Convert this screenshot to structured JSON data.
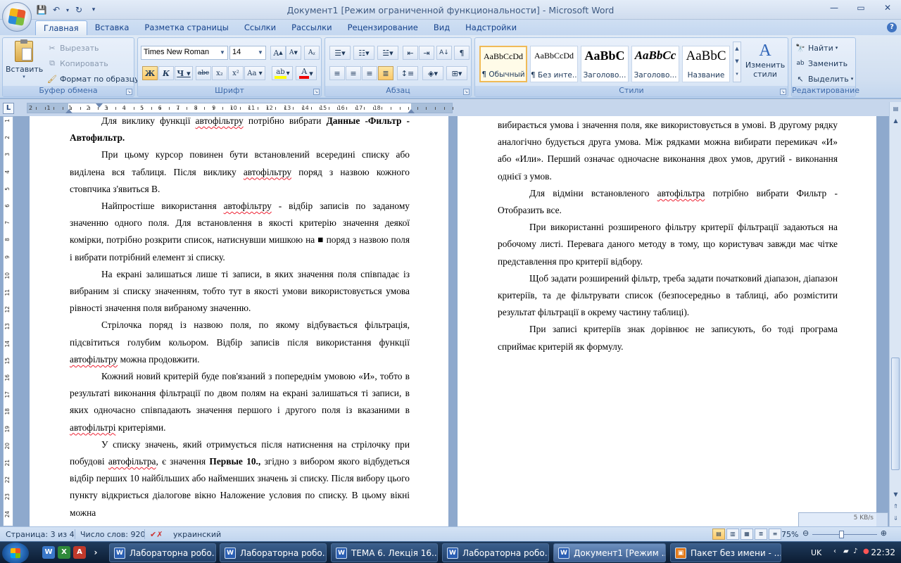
{
  "window": {
    "title": "Документ1 [Режим ограниченной функциональности] - Microsoft Word",
    "controls": [
      "—",
      "▭",
      "✕"
    ]
  },
  "tabs": [
    "Главная",
    "Вставка",
    "Разметка страницы",
    "Ссылки",
    "Рассылки",
    "Рецензирование",
    "Вид",
    "Надстройки"
  ],
  "ribbon": {
    "clipboard": {
      "label": "Буфер обмена",
      "paste": "Вставить",
      "cut": "Вырезать",
      "copy": "Копировать",
      "format_painter": "Формат по образцу"
    },
    "font": {
      "label": "Шрифт",
      "font_name": "Times New Roman",
      "font_size": "14"
    },
    "paragraph": {
      "label": "Абзац"
    },
    "styles": {
      "label": "Стили",
      "items": [
        {
          "sample": "AaBbCcDd",
          "name": "¶ Обычный"
        },
        {
          "sample": "AaBbCcDd",
          "name": "¶ Без инте..."
        },
        {
          "sample": "AaBbC",
          "name": "Заголово..."
        },
        {
          "sample": "AaBbCc",
          "name": "Заголово..."
        },
        {
          "sample": "AaBbC",
          "name": "Название"
        }
      ],
      "change_styles": "Изменить стили"
    },
    "editing": {
      "label": "Редактирование",
      "find": "Найти",
      "replace": "Заменить",
      "select": "Выделить"
    }
  },
  "ruler": {
    "ticks": [
      "2",
      "1",
      "1",
      "2",
      "3",
      "4",
      "5",
      "6",
      "7",
      "8",
      "9",
      "10",
      "11",
      "12",
      "13",
      "14",
      "15",
      "16",
      "17",
      "18"
    ],
    "vticks": [
      "1",
      "2",
      "3",
      "4",
      "5",
      "6",
      "7",
      "8",
      "9",
      "10",
      "11",
      "12",
      "13",
      "14",
      "15",
      "16",
      "17",
      "18",
      "19",
      "20",
      "21",
      "22",
      "23",
      "24",
      "25",
      "26"
    ]
  },
  "document": {
    "left_page": {
      "p1_a": "Для виклику функції ",
      "p1_w1": "автофільтру",
      "p1_b": " потрібно вибрати ",
      "p1_bold": "Данные -Фильтр - Автофильтр.",
      "p2_a": "При цьому курсор повинен бути встановлений всередині списку або виділена вся таблиця. Після виклику ",
      "p2_w1": "автофільтру",
      "p2_b": " поряд з назвою кожного стовпчика з'явиться В.",
      "p3_a": "Найпростіше використання ",
      "p3_w1": "автофільтру",
      "p3_b": " - відбір записів по заданому значенню одного поля. Для встановлення в якості критерію значення деякої комірки, потрібно розкрити список, натиснувши мишкою на ■ поряд з назвою поля і вибрати потрібний елемент зі списку.",
      "p4": "На екрані залишаться лише ті записи, в яких значення поля співпадає із вибраним зі списку значенням, тобто тут в якості умови використовується умова рівності значення поля вибраному значенню.",
      "p5_a": "Стрілочка поряд із назвою поля, по якому відбувається фільтрація, підсвітиться голубим кольором. Відбір записів після використання функції ",
      "p5_w1": "автофільтру",
      "p5_b": " можна продовжити.",
      "p6_a": "Кожний новий критерій буде пов'язаний з попереднім умовою «И», тобто в результаті виконання фільтрації по двом полям на екрані залишаться ті записи, в яких одночасно співпадають значення першого і другого поля із вказаними в ",
      "p6_w1": "автофільтрі",
      "p6_b": " критеріями.",
      "p7_a": "У списку значень, який отримується після натиснення на стрілочку при побудові ",
      "p7_w1": "автофільтра",
      "p7_b": ", є значення ",
      "p7_bold": "Первые 10.,",
      "p7_c": " згідно з вибором якого відбудеться відбір перших 10 найбільших або найменших значень зі списку. Після вибору цього пункту відкриється діалогове вікно Наложение условия по списку. В цьому вікні можна"
    },
    "right_page": {
      "p1": "вибирається умова і значення поля, яке використовується в умові. В другому рядку аналогічно будується друга умова. Між рядками можна вибирати перемикач «И» або «Или». Перший означає одночасне виконання двох умов, другий - виконання однієї з умов.",
      "p2_a": "Для відміни встановленого ",
      "p2_w1": "автофільтра",
      "p2_b": " потрібно вибрати Фильтр - Отобразить все.",
      "p3": "При використанні розширеного фільтру критерії фільтрації задаються на робочому листі. Перевага даного методу в тому, що користувач завжди має чітке представлення про критерії відбору.",
      "p4": "Щоб задати розширений фільтр, треба задати початковий діапазон, діапазон критеріїв, та де фільтрувати список (безпосередньо в таблиці, або розмістити результат фільтрації в окрему частину таблиці).",
      "p5": "При записі критеріїв знак дорівнює не записують, бо тоді програма сприймає критерій як формулу."
    }
  },
  "status": {
    "page": "Страница: 3 из 4",
    "words": "Число слов: 920",
    "language": "украинский",
    "zoom": "75%",
    "net_speed": "5 KB/s"
  },
  "taskbar": {
    "tasks": [
      "Лабораторна робо...",
      "Лабораторна робо...",
      "ТЕМА 6. Лекція 16....",
      "Лабораторна робо...",
      "Документ1 [Режим ...",
      "Пакет без имени - ..."
    ],
    "lang": "UK",
    "time": "22:32"
  }
}
